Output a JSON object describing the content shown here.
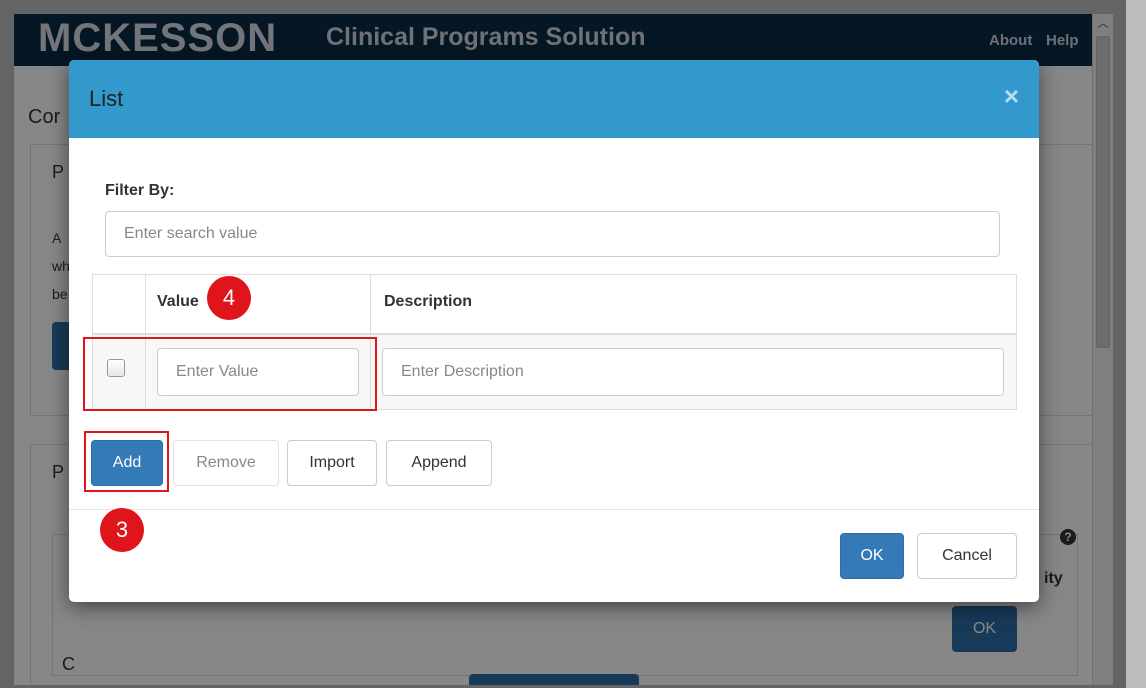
{
  "app": {
    "logo": "MCKESSON",
    "title": "Clinical Programs Solution",
    "nav": {
      "about": "About",
      "help": "Help"
    }
  },
  "background": {
    "heading_fragment": "Cor",
    "panel_fragment_1": "P",
    "text_fragment_1": "A",
    "text_fragment_2": "wh",
    "text_fragment_3": "be",
    "panel_fragment_2": "P",
    "column_fragment": "ity",
    "row_fragment": "C",
    "ok_label": "OK"
  },
  "modal": {
    "title": "List",
    "close_glyph": "×",
    "filter_label": "Filter By:",
    "search_placeholder": "Enter search value",
    "table": {
      "headers": {
        "value": "Value",
        "description": "Description"
      },
      "row": {
        "value_placeholder": "Enter Value",
        "description_placeholder": "Enter Description"
      }
    },
    "actions": {
      "add": "Add",
      "remove": "Remove",
      "import": "Import",
      "append": "Append"
    },
    "footer": {
      "ok": "OK",
      "cancel": "Cancel"
    },
    "help_glyph": "?"
  },
  "annotations": {
    "step_3": "3",
    "step_4": "4"
  },
  "colors": {
    "header_blue": "#3399cc",
    "primary_button": "#337ab7",
    "callout_red": "#e0141b",
    "topbar_navy": "#0b2a44"
  }
}
